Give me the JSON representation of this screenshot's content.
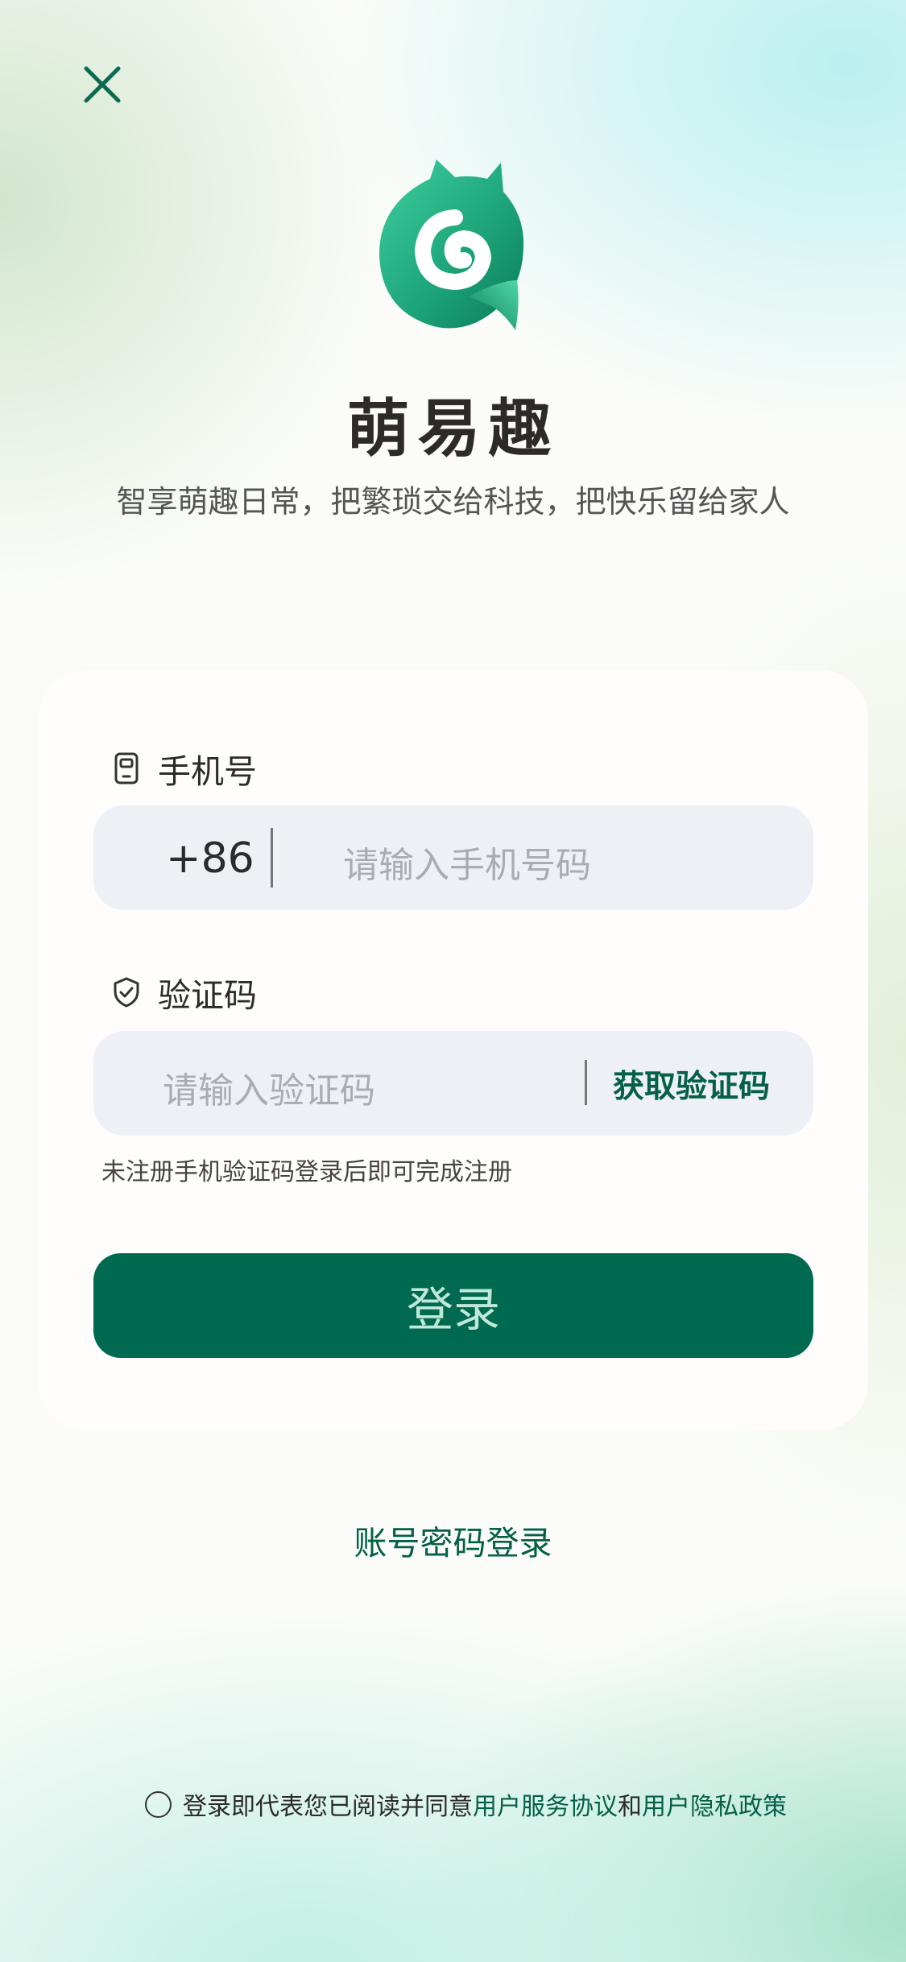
{
  "header": {
    "close_icon": "close-icon",
    "app_name": "萌易趣",
    "slogan": "智享萌趣日常，把繁琐交给科技，把快乐留给家人"
  },
  "colors": {
    "brand": "#006a50",
    "brand_text": "#046046",
    "input_bg": "#edf1f5"
  },
  "form": {
    "phone_label": "手机号",
    "phone_icon": "phone-icon",
    "country_code": "+86",
    "phone_placeholder": "请输入手机号码",
    "code_label": "验证码",
    "code_icon": "shield-check-icon",
    "code_placeholder": "请输入验证码",
    "get_code_label": "获取验证码",
    "hint": "未注册手机验证码登录后即可完成注册",
    "login_label": "登录"
  },
  "alt_login": {
    "label": "账号密码登录"
  },
  "agreement": {
    "checked": false,
    "prefix": "登录即代表您已阅读并同意",
    "terms_link": "用户服务协议",
    "conjunction": "和",
    "privacy_link": "用户隐私政策"
  }
}
